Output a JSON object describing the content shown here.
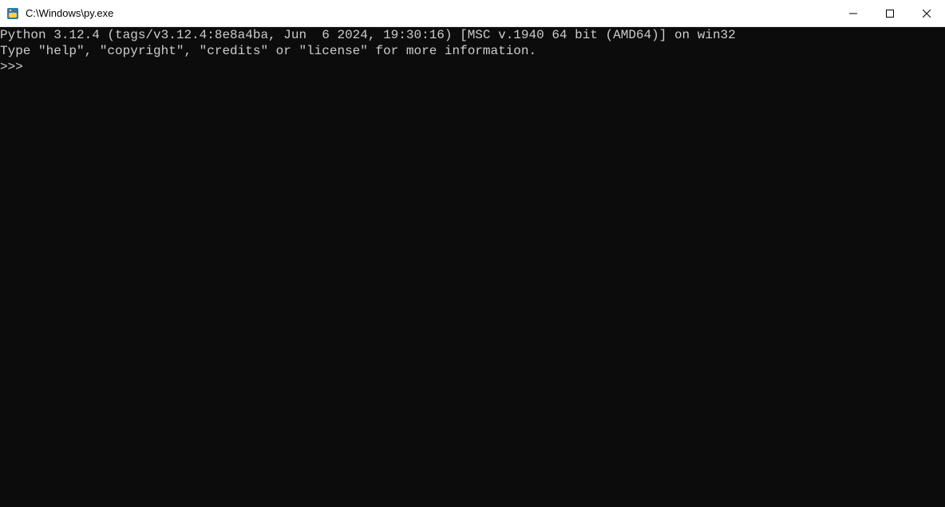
{
  "window": {
    "title": "C:\\Windows\\py.exe"
  },
  "terminal": {
    "line1": "Python 3.12.4 (tags/v3.12.4:8e8a4ba, Jun  6 2024, 19:30:16) [MSC v.1940 64 bit (AMD64)] on win32",
    "line2": "Type \"help\", \"copyright\", \"credits\" or \"license\" for more information.",
    "prompt": ">>> "
  }
}
